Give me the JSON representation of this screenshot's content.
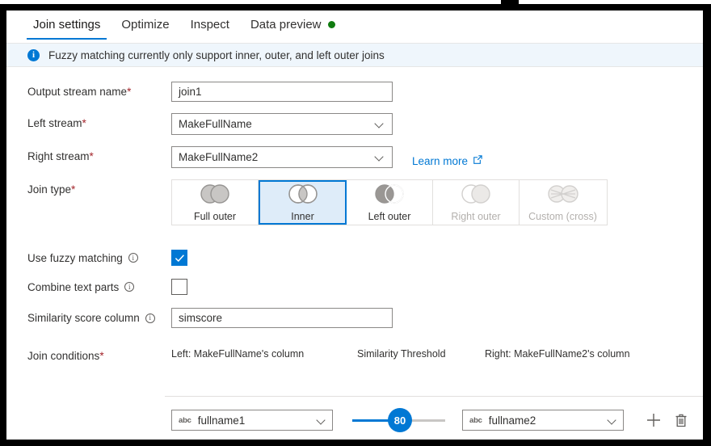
{
  "tabs": [
    {
      "label": "Join settings",
      "active": true,
      "dot": false
    },
    {
      "label": "Optimize",
      "active": false,
      "dot": false
    },
    {
      "label": "Inspect",
      "active": false,
      "dot": false
    },
    {
      "label": "Data preview",
      "active": false,
      "dot": true
    }
  ],
  "info_banner": {
    "icon": "info-icon",
    "glyph": "i",
    "message": "Fuzzy matching currently only support inner, outer, and left outer joins",
    "background": "#eff6fc",
    "icon_color": "#0078d4"
  },
  "form": {
    "output_stream": {
      "label": "Output stream name",
      "required": "*",
      "value": "join1"
    },
    "left_stream": {
      "label": "Left stream",
      "required": "*",
      "value": "MakeFullName"
    },
    "right_stream": {
      "label": "Right stream",
      "required": "*",
      "value": "MakeFullName2"
    },
    "learn_more": {
      "label": "Learn more",
      "icon": "external-link-icon",
      "color": "#0078d4"
    },
    "join_type": {
      "label": "Join type",
      "required": "*",
      "selected": "Inner",
      "accent": "#0078d4",
      "selected_background": "#deecf9",
      "options": [
        {
          "label": "Full outer",
          "venn": "full",
          "disabled": false
        },
        {
          "label": "Inner",
          "venn": "inner",
          "disabled": false
        },
        {
          "label": "Left outer",
          "venn": "left",
          "disabled": false
        },
        {
          "label": "Right outer",
          "venn": "right",
          "disabled": true
        },
        {
          "label": "Custom (cross)",
          "venn": "cross",
          "disabled": true
        }
      ]
    },
    "use_fuzzy_matching": {
      "label": "Use fuzzy matching",
      "info": "i",
      "checked": true
    },
    "combine_text_parts": {
      "label": "Combine text parts",
      "info": "i",
      "checked": false
    },
    "similarity_score_column": {
      "label": "Similarity score column",
      "info": "i",
      "value": "simscore"
    },
    "join_conditions": {
      "label": "Join conditions",
      "required": "*",
      "headers": {
        "left": "Left: MakeFullName's column",
        "middle": "Similarity Threshold",
        "right": "Right: MakeFullName2's column"
      },
      "rows": [
        {
          "left_column": "fullname1",
          "left_type": "abc",
          "threshold": "80",
          "threshold_percent": 50,
          "right_column": "fullname2",
          "right_type": "abc",
          "add_icon": "plus-icon",
          "delete_icon": "trash-icon"
        }
      ]
    }
  }
}
